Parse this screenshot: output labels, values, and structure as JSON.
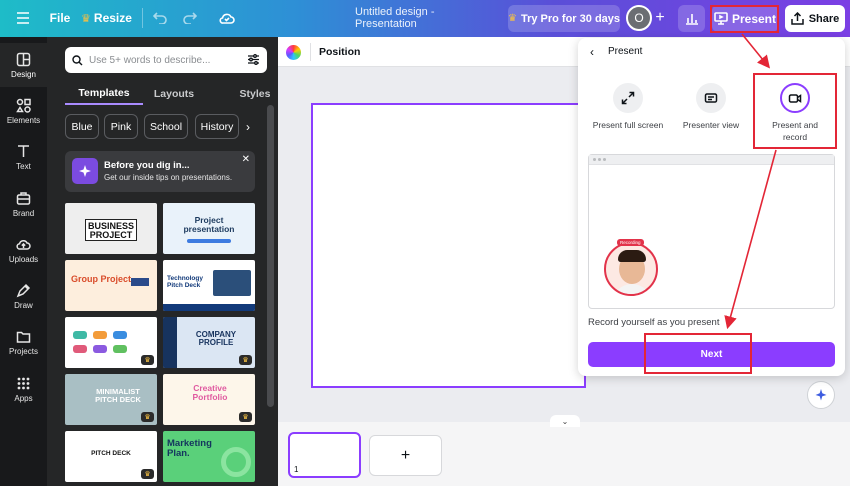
{
  "header": {
    "file_label": "File",
    "resize_label": "Resize",
    "doc_title": "Untitled design - Presentation",
    "try_pro_label": "Try Pro for 30 days",
    "avatar_initial": "O",
    "present_label": "Present",
    "share_label": "Share"
  },
  "rail": [
    {
      "label": "Design",
      "icon": "design-icon"
    },
    {
      "label": "Elements",
      "icon": "elements-icon"
    },
    {
      "label": "Text",
      "icon": "text-icon"
    },
    {
      "label": "Brand",
      "icon": "brand-icon"
    },
    {
      "label": "Uploads",
      "icon": "uploads-icon"
    },
    {
      "label": "Draw",
      "icon": "draw-icon"
    },
    {
      "label": "Projects",
      "icon": "projects-icon"
    },
    {
      "label": "Apps",
      "icon": "apps-icon"
    }
  ],
  "panel": {
    "search_placeholder": "Use 5+ words to describe...",
    "tabs": [
      "Templates",
      "Layouts",
      "Styles"
    ],
    "chips": [
      "Blue",
      "Pink",
      "School",
      "History"
    ],
    "tip_title": "Before you dig in...",
    "tip_subtitle": "Get our inside tips on presentations.",
    "thumbnails": [
      {
        "title": "BUSINESS PROJECT"
      },
      {
        "title": "Project presentation"
      },
      {
        "title": "Group Project"
      },
      {
        "title": "Technology Pitch Deck"
      },
      {
        "title": ""
      },
      {
        "title": "COMPANY PROFILE"
      },
      {
        "title": "MINIMALIST PITCH DECK"
      },
      {
        "title": "Creative Portfolio"
      },
      {
        "title": "PITCH DECK"
      },
      {
        "title": "Marketing Plan."
      }
    ]
  },
  "editor": {
    "position_label": "Position",
    "page_number": "1"
  },
  "present_popup": {
    "title": "Present",
    "options": [
      {
        "label": "Present full screen",
        "icon": "fullscreen-icon"
      },
      {
        "label": "Presenter view",
        "icon": "presenter-view-icon"
      },
      {
        "label": "Present and record",
        "icon": "record-camera-icon"
      }
    ],
    "recording_badge": "Recording",
    "description": "Record yourself as you present",
    "next_label": "Next"
  },
  "colors": {
    "accent": "#8b3dff",
    "annotation_red": "#e32636"
  }
}
